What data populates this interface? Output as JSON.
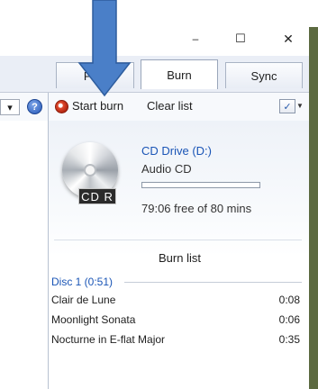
{
  "window": {
    "minimize_glyph": "–",
    "maximize_glyph": "☐",
    "close_glyph": "✕"
  },
  "tabs": [
    {
      "label": "Play",
      "active": false
    },
    {
      "label": "Burn",
      "active": true
    },
    {
      "label": "Sync",
      "active": false
    }
  ],
  "toolbar": {
    "dropdown_arrow": "▾",
    "help_label": "?",
    "start_burn": "Start burn",
    "clear_list": "Clear list",
    "options_icon": "check-list-icon",
    "options_glyph": "✓",
    "options_arrow": "▼"
  },
  "burn_panel": {
    "disc_badge": "CD R",
    "drive_name": "CD Drive (D:)",
    "disc_type": "Audio CD",
    "capacity_used_fraction": 0.0,
    "free_space": "79:06 free of 80 mins",
    "list_title": "Burn list",
    "disc_header": "Disc 1 (0:51)",
    "tracks": [
      {
        "title": "Clair de Lune",
        "length": "0:08"
      },
      {
        "title": "Moonlight Sonata",
        "length": "0:06"
      },
      {
        "title": "Nocturne in E-flat Major",
        "length": "0:35"
      }
    ]
  },
  "colors": {
    "accent_blue": "#1a55b6",
    "annotation_arrow": "#4a7fc8",
    "annotation_arrow_stroke": "#2e5d9e",
    "window_edge_green": "#5c6a40"
  }
}
